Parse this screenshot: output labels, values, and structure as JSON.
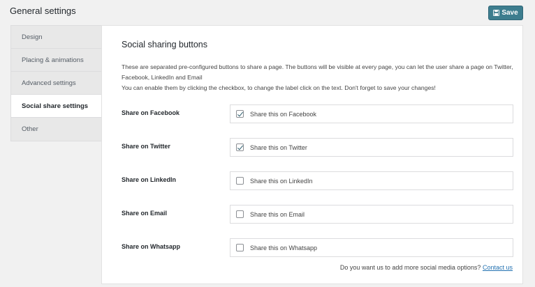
{
  "header": {
    "title": "General settings",
    "save_label": "Save"
  },
  "tabs": [
    {
      "label": "Design",
      "active": false
    },
    {
      "label": "Placing & animations",
      "active": false
    },
    {
      "label": "Advanced settings",
      "active": false
    },
    {
      "label": "Social share settings",
      "active": true
    },
    {
      "label": "Other",
      "active": false
    }
  ],
  "panel": {
    "title": "Social sharing buttons",
    "description_line1": "These are separated pre-configured buttons to share a page. The buttons will be visible at every page, you can let the user share a page on Twitter, Facebook, LinkedIn and Email",
    "description_line2": "You can enable them by clicking the checkbox, to change the label click on the text. Don't forget to save your changes!",
    "rows": [
      {
        "label": "Share on Facebook",
        "text": "Share this on Facebook",
        "checked": true
      },
      {
        "label": "Share on Twitter",
        "text": "Share this on Twitter",
        "checked": true
      },
      {
        "label": "Share on LinkedIn",
        "text": "Share this on LinkedIn",
        "checked": false
      },
      {
        "label": "Share on Email",
        "text": "Share this on Email",
        "checked": false
      },
      {
        "label": "Share on Whatsapp",
        "text": "Share this on Whatsapp",
        "checked": false
      }
    ],
    "footer_text": "Do you want us to add more social media options?",
    "footer_link": "Contact us"
  },
  "colors": {
    "accent": "#3d7d8e",
    "link": "#2271b1"
  }
}
